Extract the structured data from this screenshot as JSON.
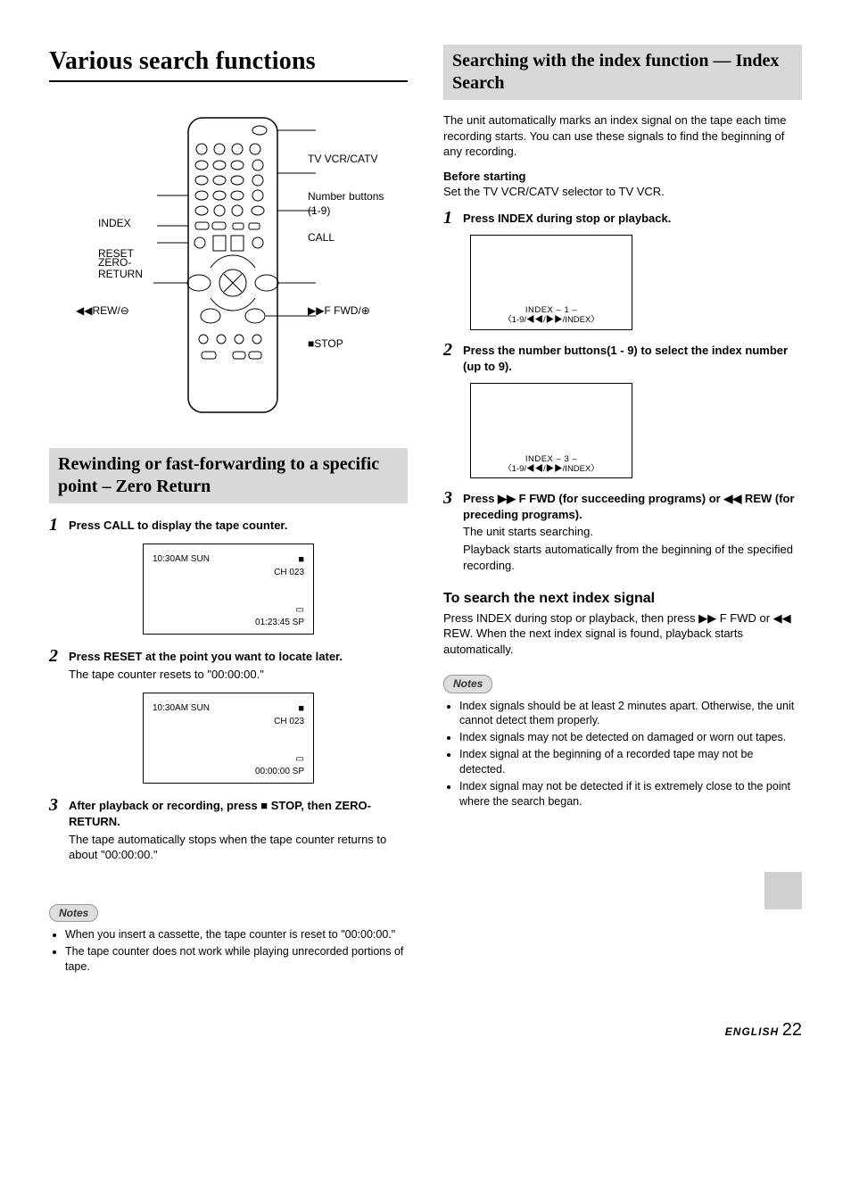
{
  "page": {
    "main_title": "Various search functions",
    "footer_lang": "ENGLISH",
    "footer_page": "22"
  },
  "remote_labels": {
    "tv_vcr_catv": "TV VCR/CATV",
    "number_buttons": "Number buttons (1-9)",
    "index": "INDEX",
    "reset": "RESET",
    "zero_return": "ZERO-RETURN",
    "rew": "◀◀REW/⊖",
    "call": "CALL",
    "ffwd": "▶▶F FWD/⊕",
    "stop": "■STOP"
  },
  "zero_return": {
    "title": "Rewinding or fast-forwarding to a specific point – Zero Return",
    "step1_lead": "Press CALL to display the tape counter.",
    "osd1": {
      "time": "10:30AM SUN",
      "ch": "CH 023",
      "icon": "■",
      "cass": "▭",
      "counter": "01:23:45  SP"
    },
    "step2_lead": "Press RESET at the point you want to locate later.",
    "step2_body": "The tape counter resets to \"00:00:00.\"",
    "osd2": {
      "time": "10:30AM SUN",
      "ch": "CH 023",
      "icon": "■",
      "cass": "▭",
      "counter": "00:00:00  SP"
    },
    "step3_lead": "After playback or recording, press ■ STOP, then ZERO-RETURN.",
    "step3_body": "The tape automatically stops when the tape counter returns to about \"00:00:00.\"",
    "notes_label": "Notes",
    "notes": [
      "When you insert a cassette, the tape counter is reset to \"00:00:00.\"",
      "The tape counter does not work while playing unrecorded portions of tape."
    ]
  },
  "index_search": {
    "title": "Searching with the index function — Index Search",
    "intro": "The unit automatically marks an index signal on the tape each time recording starts. You can use these signals to find the beginning of any recording.",
    "before_label": "Before starting",
    "before_body": "Set the TV VCR/CATV selector to TV VCR.",
    "step1_lead": "Press INDEX during stop or playback.",
    "osd1": {
      "l1": "INDEX – 1 –",
      "l2": "〈1-9/◀◀/▶▶/INDEX〉"
    },
    "step2_lead": "Press the number buttons(1 - 9) to select the index number (up to 9).",
    "osd2": {
      "l1": "INDEX – 3 –",
      "l2": "〈1-9/◀◀/▶▶/INDEX〉"
    },
    "step3_lead": "Press ▶▶ F FWD (for succeeding programs) or ◀◀ REW (for preceding programs).",
    "step3_b1": "The unit starts searching.",
    "step3_b2": "Playback starts automatically from the beginning of the specified recording.",
    "next_title": "To search the next index signal",
    "next_body": "Press INDEX during stop or playback, then press ▶▶ F FWD or ◀◀ REW.  When the next index signal is found, playback starts automatically.",
    "notes_label": "Notes",
    "notes": [
      "Index signals should be at least 2 minutes apart. Otherwise, the unit cannot detect them properly.",
      "Index signals may not be detected on damaged or worn out tapes.",
      "Index signal at the beginning of a recorded tape may not be detected.",
      "Index signal may not be detected if it is extremely close to the point where the search began."
    ]
  }
}
